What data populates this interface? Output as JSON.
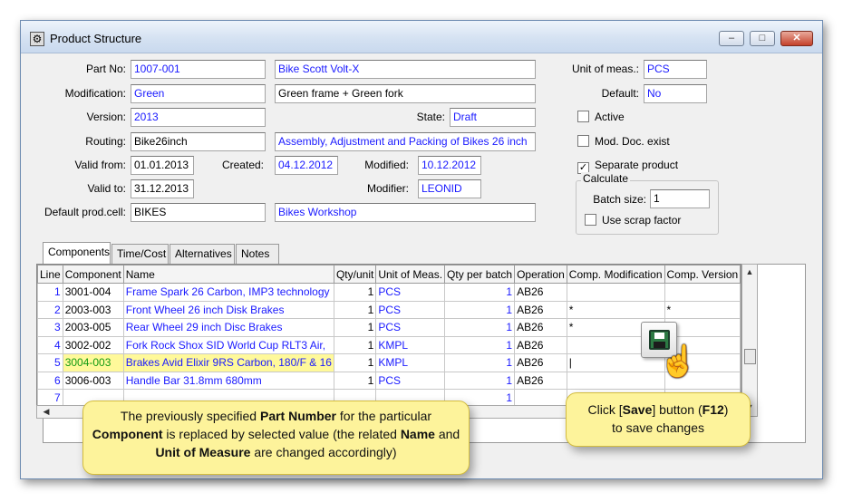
{
  "window": {
    "title": "Product Structure",
    "buttons": {
      "minimize": "–",
      "maximize": "□",
      "close": "✕"
    }
  },
  "form": {
    "part_no": {
      "label": "Part No:",
      "value": "1007-001",
      "desc": "Bike Scott Volt-X"
    },
    "modification": {
      "label": "Modification:",
      "value": "Green",
      "desc": "Green frame + Green fork"
    },
    "version": {
      "label": "Version:",
      "value": "2013"
    },
    "state": {
      "label": "State:",
      "value": "Draft"
    },
    "routing": {
      "label": "Routing:",
      "value": "Bike26inch",
      "desc": "Assembly, Adjustment and Packing of Bikes 26 inch"
    },
    "valid_from": {
      "label": "Valid from:",
      "value": "01.01.2013"
    },
    "created": {
      "label": "Created:",
      "value": "04.12.2012"
    },
    "modified": {
      "label": "Modified:",
      "value": "10.12.2012"
    },
    "valid_to": {
      "label": "Valid to:",
      "value": "31.12.2013"
    },
    "modifier": {
      "label": "Modifier:",
      "value": "LEONID"
    },
    "default_prod_cell": {
      "label": "Default prod.cell:",
      "value": "BIKES",
      "desc": "Bikes Workshop"
    },
    "unit_of_meas": {
      "label": "Unit of meas.:",
      "value": "PCS"
    },
    "default": {
      "label": "Default:",
      "value": "No"
    },
    "active": {
      "label": "Active",
      "checked": false
    },
    "mod_doc_exist": {
      "label": "Mod. Doc. exist",
      "checked": false
    },
    "separate_product": {
      "label": "Separate product",
      "checked": true
    },
    "calculate": {
      "title": "Calculate",
      "batch_size_label": "Batch size:",
      "batch_size": "1",
      "use_scrap_label": "Use scrap factor"
    }
  },
  "tabs": [
    {
      "label": "Components"
    },
    {
      "label": "Time/Cost"
    },
    {
      "label": "Alternatives"
    },
    {
      "label": "Notes"
    }
  ],
  "grid": {
    "columns": [
      "Line",
      "Component",
      "Name",
      "Qty/unit",
      "Unit of Meas.",
      "Qty per batch",
      "Operation",
      "Comp. Modification",
      "Comp. Version"
    ],
    "rows": [
      {
        "line": "1",
        "component": "3001-004",
        "name": "Frame Spark 26 Carbon, IMP3 technology",
        "qty": "1",
        "uom": "PCS",
        "batch": "1",
        "op": "AB26",
        "mod": "",
        "ver": ""
      },
      {
        "line": "2",
        "component": "2003-003",
        "name": "Front Wheel 26 inch Disk Brakes",
        "qty": "1",
        "uom": "PCS",
        "batch": "1",
        "op": "AB26",
        "mod": "*",
        "ver": "*"
      },
      {
        "line": "3",
        "component": "2003-005",
        "name": "Rear Wheel 29 inch Disc Brakes",
        "qty": "1",
        "uom": "PCS",
        "batch": "1",
        "op": "AB26",
        "mod": "*",
        "ver": "*"
      },
      {
        "line": "4",
        "component": "3002-002",
        "name": "Fork Rock Shox SID World Cup RLT3 Air,",
        "qty": "1",
        "uom": "KMPL",
        "batch": "1",
        "op": "AB26",
        "mod": "",
        "ver": ""
      },
      {
        "line": "5",
        "component": "3004-003",
        "name": "Brakes Avid Elixir 9RS Carbon, 180/F & 16",
        "qty": "1",
        "uom": "KMPL",
        "batch": "1",
        "op": "AB26",
        "mod": "|",
        "ver": ""
      },
      {
        "line": "6",
        "component": "3006-003",
        "name": "Handle Bar 31.8mm 680mm",
        "qty": "1",
        "uom": "PCS",
        "batch": "1",
        "op": "AB26",
        "mod": "",
        "ver": ""
      },
      {
        "line": "7",
        "component": "",
        "name": "",
        "qty": "",
        "uom": "",
        "batch": "1",
        "op": "",
        "mod": "",
        "ver": ""
      }
    ]
  },
  "callouts": {
    "part_number": {
      "t1": "The previously specified ",
      "b1": "Part Number",
      "t2": " for the particular ",
      "b2": "Component",
      "t3": " is replaced by selected value (the related ",
      "b3": "Name",
      "t4": " and ",
      "b4": "Unit of Measure",
      "t5": " are changed accordingly)"
    },
    "save": {
      "t1": "Click [",
      "b1": "Save",
      "t2": "] button (",
      "b2": "F12",
      "t3": ")",
      "t4": "to save changes"
    }
  }
}
